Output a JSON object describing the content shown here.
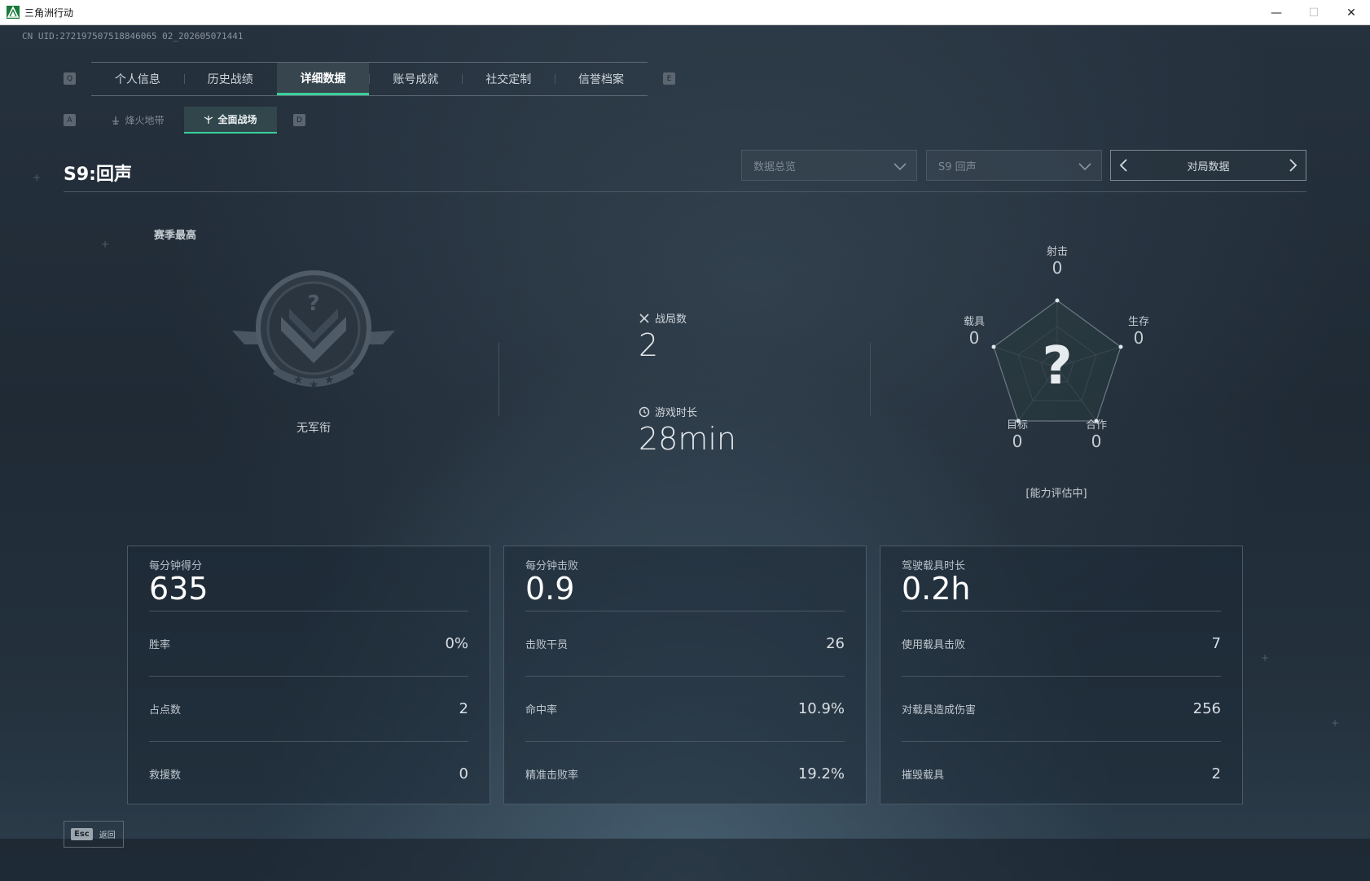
{
  "window": {
    "title": "三角洲行动",
    "minimize": "—",
    "maximize": "☐",
    "close": "✕"
  },
  "uid": "CN UID:272197507518846065 02_202605071441",
  "main_tabs": [
    {
      "label": "个人信息",
      "active": false
    },
    {
      "label": "历史战绩",
      "active": false
    },
    {
      "label": "详细数据",
      "active": true
    },
    {
      "label": "账号成就",
      "active": false
    },
    {
      "label": "社交定制",
      "active": false
    },
    {
      "label": "信誉档案",
      "active": false
    }
  ],
  "main_tab_keys": {
    "left": "Q",
    "right": "E"
  },
  "sub_tabs": [
    {
      "label": "烽火地带",
      "active": false,
      "icon": "flame-zone-icon"
    },
    {
      "label": "全面战场",
      "active": true,
      "icon": "battlefield-icon"
    }
  ],
  "sub_tab_keys": {
    "left": "A",
    "right": "D"
  },
  "season": {
    "title": "S9:回声"
  },
  "filters": {
    "overview": "数据总览",
    "season": "S9 回声",
    "match_data": "对局数据"
  },
  "season_best": {
    "label": "赛季最高",
    "rank_name": "无军衔"
  },
  "stats": {
    "matches_label": "战局数",
    "matches_value": "2",
    "playtime_label": "游戏时长",
    "playtime_value": "28min"
  },
  "radar": {
    "axes": [
      {
        "label": "射击",
        "value": "0"
      },
      {
        "label": "生存",
        "value": "0"
      },
      {
        "label": "合作",
        "value": "0"
      },
      {
        "label": "目标",
        "value": "0"
      },
      {
        "label": "载具",
        "value": "0"
      }
    ],
    "center_glyph": "?",
    "status": "[能力评估中]"
  },
  "cards": [
    {
      "head_label": "每分钟得分",
      "head_value": "635",
      "rows": [
        {
          "k": "胜率",
          "v": "0%"
        },
        {
          "k": "占点数",
          "v": "2"
        },
        {
          "k": "救援数",
          "v": "0"
        }
      ]
    },
    {
      "head_label": "每分钟击败",
      "head_value": "0.9",
      "rows": [
        {
          "k": "击败干员",
          "v": "26"
        },
        {
          "k": "命中率",
          "v": "10.9%"
        },
        {
          "k": "精准击败率",
          "v": "19.2%"
        }
      ]
    },
    {
      "head_label": "驾驶载具时长",
      "head_value": "0.2h",
      "rows": [
        {
          "k": "使用载具击败",
          "v": "7"
        },
        {
          "k": "对载具造成伤害",
          "v": "256"
        },
        {
          "k": "摧毁载具",
          "v": "2"
        }
      ]
    }
  ],
  "bottom": {
    "esc_key": "Esc",
    "back_label": "返回"
  },
  "colors": {
    "accent": "#39d09a",
    "bg": "#1c2631"
  }
}
